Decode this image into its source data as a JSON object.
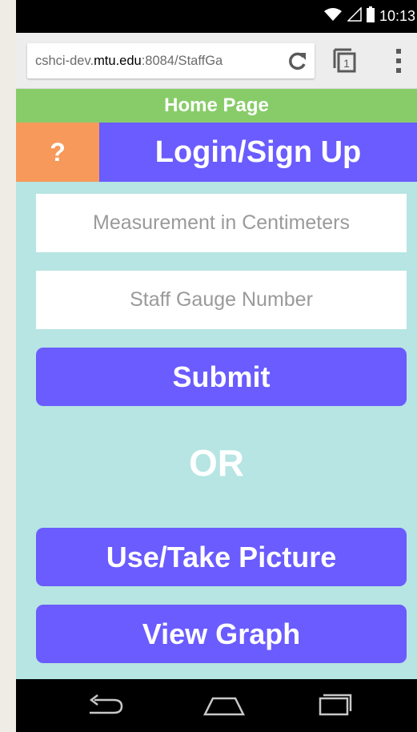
{
  "status_bar": {
    "time": "10:13",
    "icons": [
      "wifi-icon",
      "signal-icon",
      "battery-icon"
    ]
  },
  "browser": {
    "url_prefix": "cshci-dev.",
    "url_host": "mtu.edu",
    "url_suffix": ":8084/StaffGa",
    "tab_count": "1",
    "icons": [
      "reload-icon",
      "tabs-icon",
      "menu-icon"
    ]
  },
  "page": {
    "home_label": "Home Page",
    "help_label": "?",
    "login_label": "Login/Sign Up",
    "measurement_placeholder": "Measurement in Centimeters",
    "gauge_placeholder": "Staff Gauge Number",
    "submit_label": "Submit",
    "or_label": "OR",
    "picture_label": "Use/Take Picture",
    "graph_label": "View Graph"
  },
  "colors": {
    "background": "#b6e5e3",
    "home_bar": "#88cc6a",
    "accent_purple": "#6a5cff",
    "help_orange": "#f7995a"
  },
  "nav_bar": {
    "icons": [
      "back-icon",
      "home-icon",
      "recents-icon"
    ]
  }
}
